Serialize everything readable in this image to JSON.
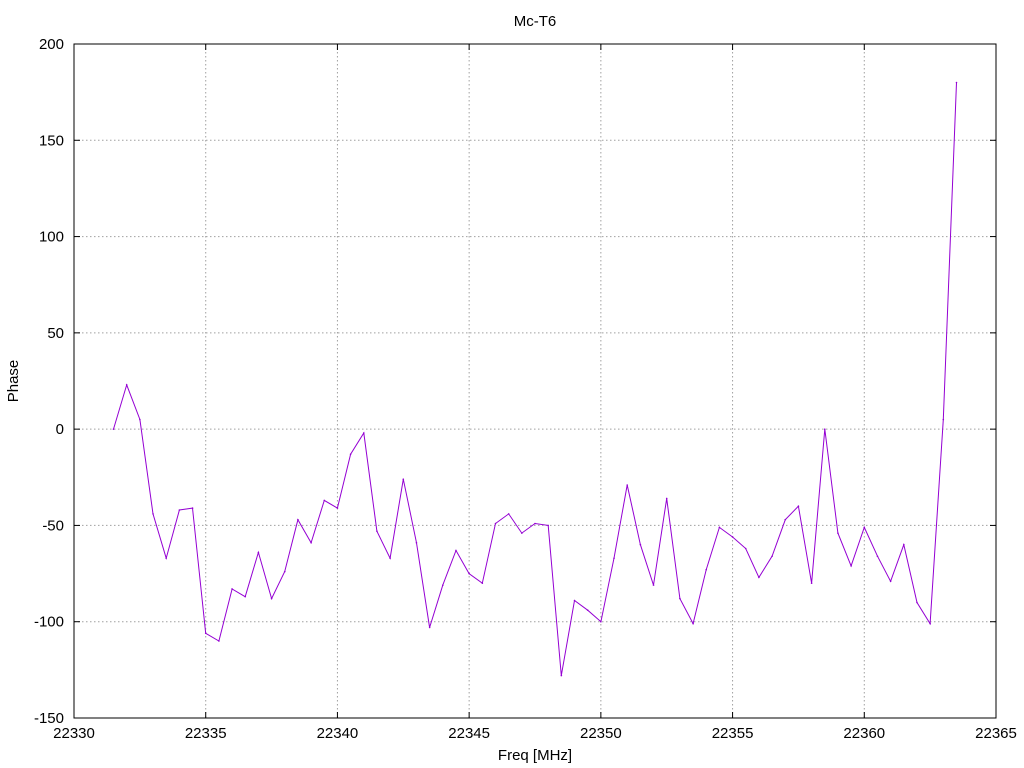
{
  "chart_data": {
    "type": "line",
    "title": "Mc-T6",
    "xlabel": "Freq [MHz]",
    "ylabel": "Phase",
    "xlim": [
      22330,
      22365
    ],
    "ylim": [
      -150,
      200
    ],
    "xticks": [
      22330,
      22335,
      22340,
      22345,
      22350,
      22355,
      22360,
      22365
    ],
    "yticks": [
      -150,
      -100,
      -50,
      0,
      50,
      100,
      150,
      200
    ],
    "grid": true,
    "line_color": "#9400d3",
    "series": [
      {
        "x": [
          22331.5,
          22332.0,
          22332.5,
          22333.0,
          22333.5,
          22334.0,
          22334.5,
          22335.0,
          22335.5,
          22336.0,
          22336.5,
          22337.0,
          22337.5,
          22338.0,
          22338.5,
          22339.0,
          22339.5,
          22340.0,
          22340.5,
          22341.0,
          22341.5,
          22342.0,
          22342.5,
          22343.0,
          22343.5,
          22344.0,
          22344.5,
          22345.0,
          22345.5,
          22346.0,
          22346.5,
          22347.0,
          22347.5,
          22348.0,
          22348.5,
          22349.0,
          22349.5,
          22350.0,
          22350.5,
          22351.0,
          22351.5,
          22352.0,
          22352.5,
          22353.0,
          22353.5,
          22354.0,
          22354.5,
          22355.0,
          22355.5,
          22356.0,
          22356.5,
          22357.0,
          22357.5,
          22358.0,
          22358.5,
          22359.0,
          22359.5,
          22360.0,
          22360.5,
          22361.0,
          22361.5,
          22362.0,
          22362.5,
          22363.0,
          22363.5
        ],
        "y": [
          0,
          23,
          5,
          -44,
          -67,
          -42,
          -41,
          -106,
          -110,
          -83,
          -87,
          -64,
          -88,
          -74,
          -47,
          -59,
          -37,
          -41,
          -13,
          -2,
          -53,
          -67,
          -26,
          -59,
          -103,
          -81,
          -63,
          -75,
          -80,
          -49,
          -44,
          -54,
          -49,
          -50,
          -128,
          -89,
          -94,
          -100,
          -67,
          -29,
          -60,
          -81,
          -36,
          -88,
          -101,
          -73,
          -51,
          -56,
          -62,
          -77,
          -66,
          -47,
          -40,
          -80,
          0,
          -54,
          -71,
          -51,
          -66,
          -79,
          -60,
          -90,
          -101,
          5,
          180
        ]
      }
    ]
  }
}
